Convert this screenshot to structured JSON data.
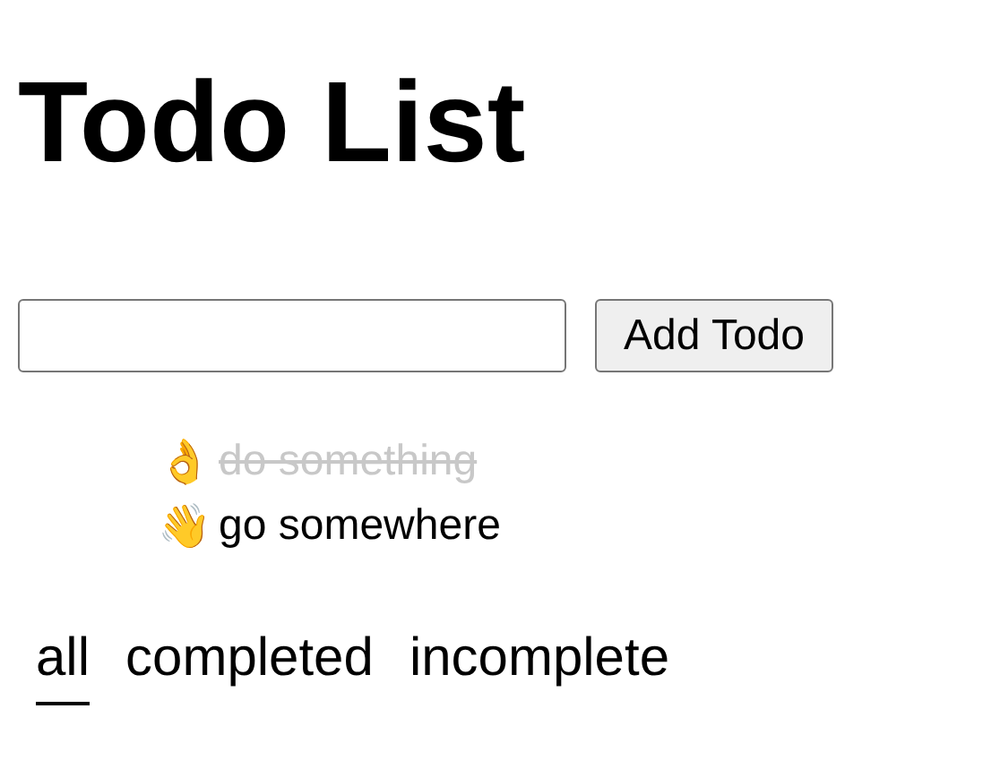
{
  "title": "Todo List",
  "form": {
    "button": "Add Todo"
  },
  "todos": [
    {
      "icon": "👌",
      "text": "do something",
      "completed": true
    },
    {
      "icon": "👋",
      "text": "go somewhere",
      "completed": false
    }
  ],
  "filters": [
    {
      "label": "all",
      "selected": true
    },
    {
      "label": "completed",
      "selected": false
    },
    {
      "label": "incomplete",
      "selected": false
    }
  ]
}
